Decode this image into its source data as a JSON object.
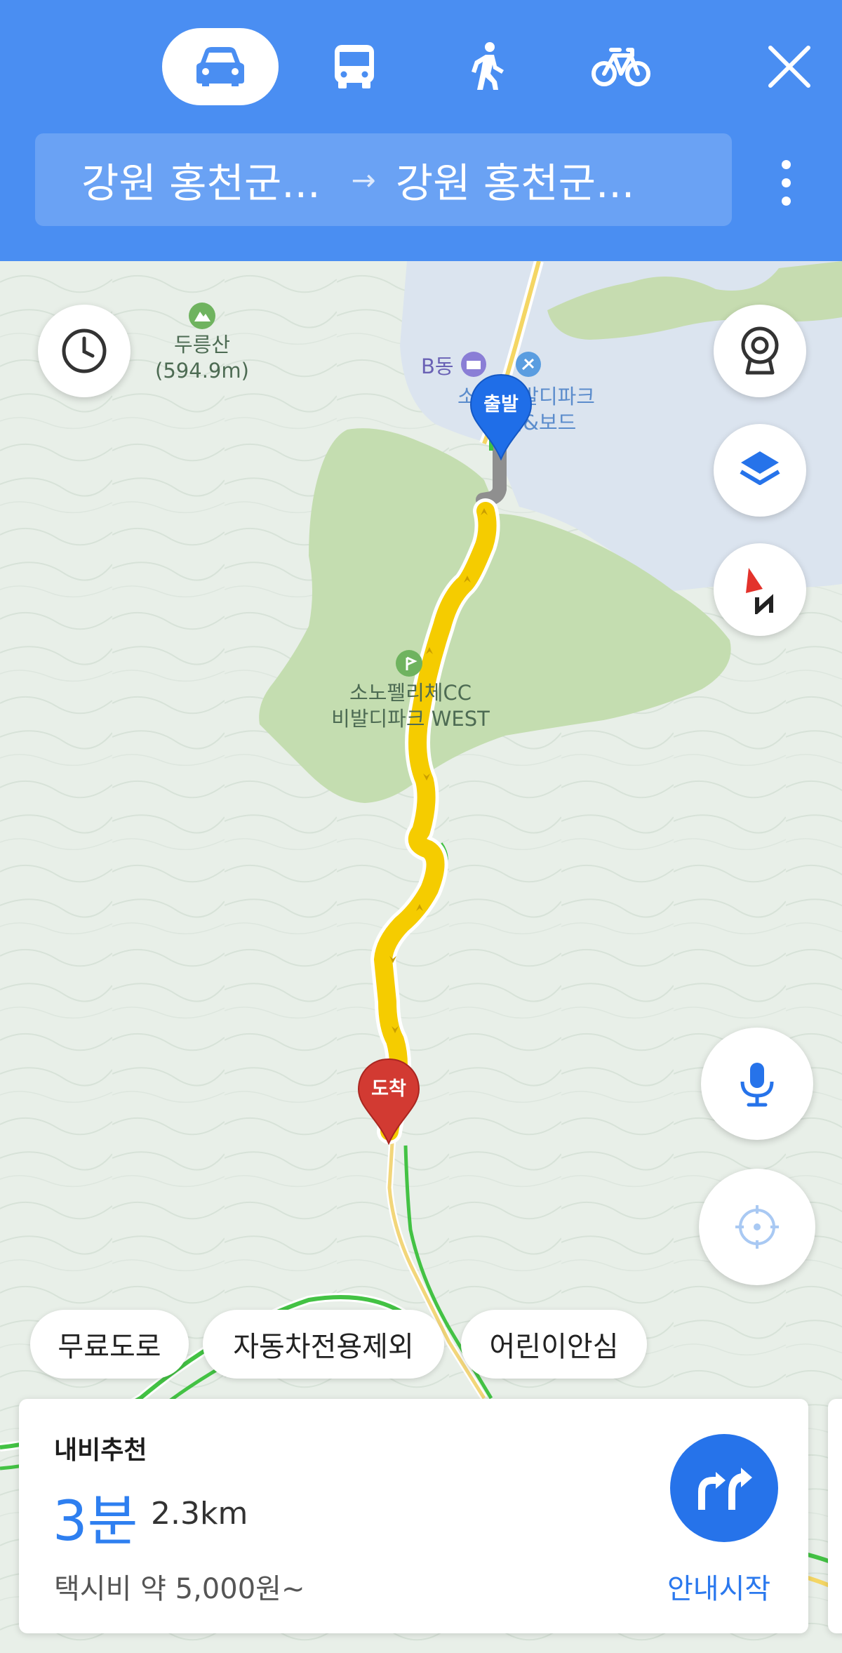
{
  "header": {
    "modes": [
      {
        "name": "car",
        "icon": "car-icon",
        "selected": true
      },
      {
        "name": "bus",
        "icon": "bus-icon",
        "selected": false
      },
      {
        "name": "walk",
        "icon": "walk-icon",
        "selected": false
      },
      {
        "name": "bike",
        "icon": "bike-icon",
        "selected": false
      }
    ],
    "close_icon": "close-icon",
    "origin": "강원 홍천군...",
    "arrow": "→",
    "destination": "강원 홍천군...",
    "more_icon": "more-vertical-icon",
    "colors": {
      "bar": "#4a8ef2",
      "route_box": "#6aa2f4"
    }
  },
  "map": {
    "labels": {
      "mountain_name": "두릉산",
      "mountain_height": "(594.9m)",
      "building": "B동",
      "ski_line1": "소노 비발디파크",
      "ski_line2": "스키&보드",
      "golf_line1": "소노펠리체CC",
      "golf_line2": "비발디파크 WEST"
    },
    "markers": {
      "start": "출발",
      "end": "도착"
    },
    "route_color": "#f5cc00",
    "start_marker_color": "#1f6ee8",
    "end_marker_color": "#d23a32"
  },
  "controls": {
    "history_icon": "clock-icon",
    "cctv_icon": "cctv-camera-icon",
    "layers_icon": "layers-icon",
    "compass_icon": "compass-icon",
    "mic_icon": "microphone-icon",
    "locate_icon": "my-location-icon"
  },
  "filters": [
    "무료도로",
    "자동차전용제외",
    "어린이안심"
  ],
  "route_card": {
    "title": "내비추천",
    "time": "3분",
    "distance": "2.3km",
    "fare": "택시비 약 5,000원~",
    "start_label": "안내시작",
    "nav_icon": "navigation-turn-icon",
    "accent": "#2e7ff0"
  }
}
